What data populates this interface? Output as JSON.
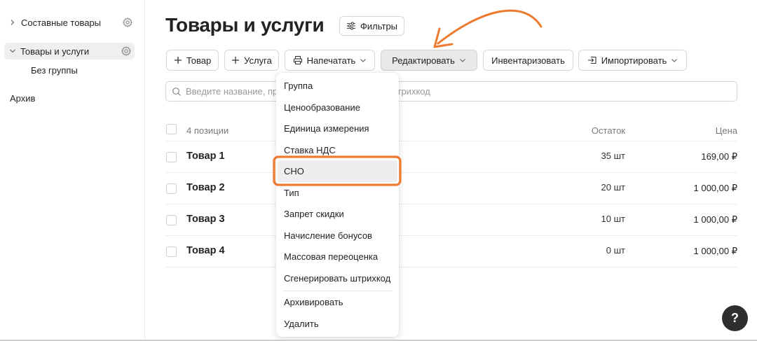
{
  "sidebar": {
    "items": [
      {
        "label": "Составные товары"
      },
      {
        "label": "Товары и услуги"
      },
      {
        "label": "Без группы"
      },
      {
        "label": "Архив"
      }
    ]
  },
  "header": {
    "title": "Товары и услуги",
    "filters_label": "Фильтры"
  },
  "toolbar": {
    "add_product": "Товар",
    "add_service": "Услуга",
    "print": "Напечатать",
    "edit": "Редактировать",
    "inventory": "Инвентаризовать",
    "import": "Импортировать"
  },
  "search": {
    "placeholder": "Введите название, производителя, артикул или штрихкод"
  },
  "table": {
    "count_label": "4 позиции",
    "col_stock": "Остаток",
    "col_price": "Цена",
    "rows": [
      {
        "name": "Товар 1",
        "stock": "35 шт",
        "price": "169,00 ₽"
      },
      {
        "name": "Товар 2",
        "stock": "20 шт",
        "price": "1 000,00 ₽"
      },
      {
        "name": "Товар 3",
        "stock": "10 шт",
        "price": "1 000,00 ₽"
      },
      {
        "name": "Товар 4",
        "stock": "0 шт",
        "price": "1 000,00 ₽"
      }
    ]
  },
  "edit_menu": {
    "items": [
      "Группа",
      "Ценообразование",
      "Единица измерения",
      "Ставка НДС",
      "СНО",
      "Тип",
      "Запрет скидки",
      "Начисление бонусов",
      "Массовая переоценка",
      "Сгенерировать штрихкод",
      "Архивировать",
      "Удалить"
    ],
    "highlighted": "СНО"
  },
  "help_label": "?",
  "colors": {
    "annotation": "#ec7a2f",
    "help_bg": "#2e2e2e"
  }
}
